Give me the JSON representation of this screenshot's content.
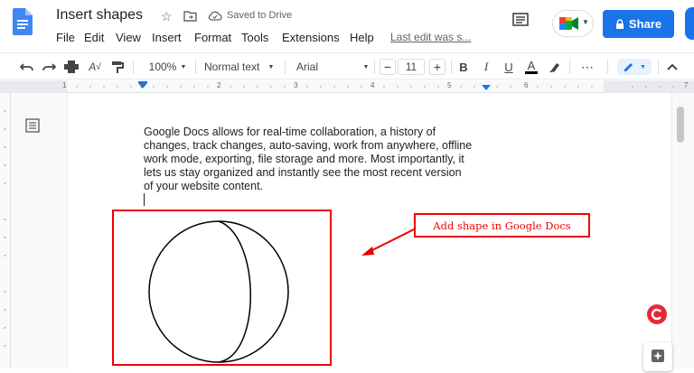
{
  "header": {
    "title": "Insert shapes",
    "saved_status": "Saved to Drive",
    "share_label": "Share",
    "last_edit": "Last edit was s..."
  },
  "menu": [
    "File",
    "Edit",
    "View",
    "Insert",
    "Format",
    "Tools",
    "Extensions",
    "Help"
  ],
  "toolbar": {
    "zoom": "100%",
    "style": "Normal text",
    "font": "Arial",
    "font_size": "11",
    "bold": "B",
    "italic": "I",
    "underline": "U",
    "text_color": "A",
    "more": "⋯"
  },
  "ruler": {
    "numbers": [
      "1",
      "1",
      "2",
      "3",
      "4",
      "5",
      "6",
      "7"
    ]
  },
  "document": {
    "lines": [
      "Google Docs allows for real-time collaboration, a history of",
      "changes, track changes, auto-saving, work from anywhere, offline",
      "work mode, exporting, file storage and more. Most importantly, it",
      "lets us stay organized and instantly see the most recent version",
      "of your website content."
    ]
  },
  "annotation": {
    "callout_text": "Add shape in Google Docs"
  },
  "colors": {
    "accent": "#1a73e8",
    "annotation": "#e00000",
    "docs_blue": "#4285f4"
  }
}
